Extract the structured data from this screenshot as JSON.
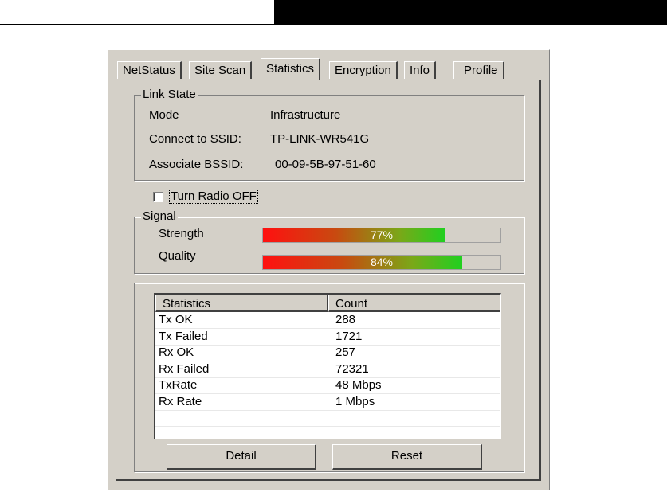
{
  "tabs": [
    "NetStatus",
    "Site Scan",
    "Statistics",
    "Encryption",
    "Info",
    "Profile"
  ],
  "active_tab": "Statistics",
  "link_state": {
    "title": "Link State",
    "mode_label": "Mode",
    "mode_value": "Infrastructure",
    "ssid_label": "Connect to SSID:",
    "ssid_value": "TP-LINK-WR541G",
    "bssid_label": "Associate BSSID:",
    "bssid_value": "00-09-5B-97-51-60"
  },
  "radio": {
    "label": "Turn Radio OFF",
    "checked": false
  },
  "signal": {
    "title": "Signal",
    "strength_label": "Strength",
    "strength_value": "77%",
    "strength_fraction": 0.77,
    "quality_label": "Quality",
    "quality_value": "84%",
    "quality_fraction": 0.84
  },
  "statistics": {
    "columns": [
      "Statistics",
      "Count"
    ],
    "rows": [
      [
        "Tx OK",
        "288"
      ],
      [
        "Tx Failed",
        "1721"
      ],
      [
        "Rx OK",
        "257"
      ],
      [
        "Rx Failed",
        "72321"
      ],
      [
        "TxRate",
        "48 Mbps"
      ],
      [
        "Rx Rate",
        "1 Mbps"
      ]
    ]
  },
  "buttons": {
    "detail": "Detail",
    "reset": "Reset"
  }
}
